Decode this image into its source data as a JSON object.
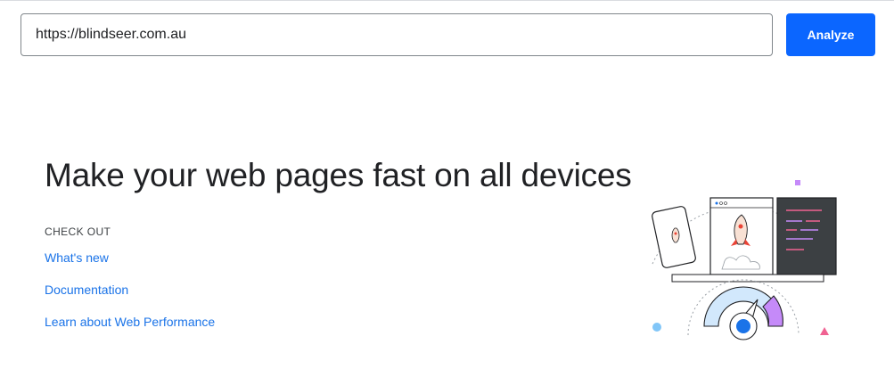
{
  "search": {
    "value": "https://blindseer.com.au",
    "button_label": "Analyze"
  },
  "hero": {
    "title": "Make your web pages fast on all devices",
    "section_label": "CHECK OUT",
    "links": [
      "What's new",
      "Documentation",
      "Learn about Web Performance"
    ]
  },
  "colors": {
    "accent": "#0b66ff",
    "link": "#1a73e8",
    "text": "#202124",
    "border": "#80868b"
  },
  "illustration": {
    "name": "devices-speed-illustration",
    "icons": [
      "rocket-icon",
      "gauge-icon",
      "code-editor-icon"
    ]
  }
}
